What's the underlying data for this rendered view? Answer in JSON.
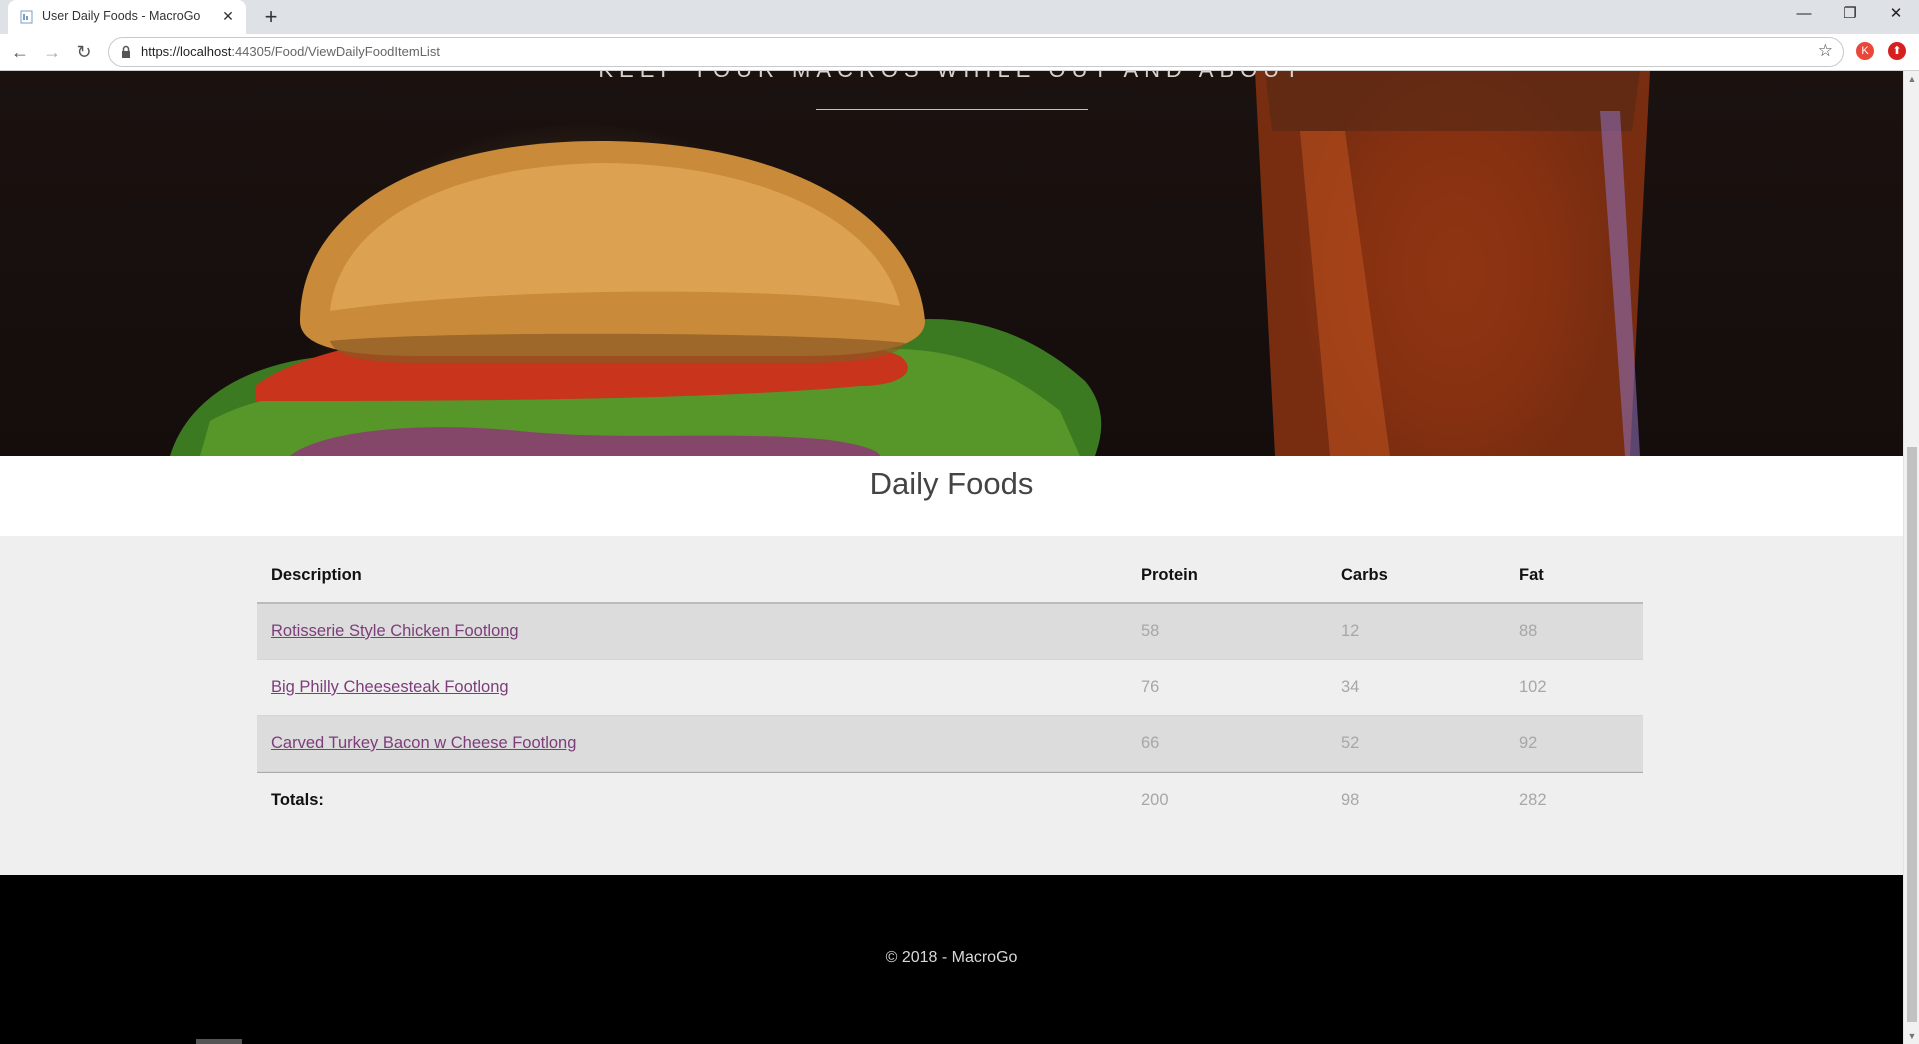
{
  "browser": {
    "tab_title": "User Daily Foods - MacroGo",
    "tab_close": "✕",
    "new_tab": "+",
    "url_host": "https://localhost",
    "url_path": ":44305/Food/ViewDailyFoodItemList",
    "profile_initial": "K",
    "window": {
      "minimize": "—",
      "restore": "❐",
      "close": "✕"
    },
    "nav": {
      "back": "←",
      "forward": "→",
      "reload": "↻",
      "bookmark": "☆"
    }
  },
  "hero": {
    "subtitle": "KEEP YOUR MACROS WHILE OUT AND ABOUT"
  },
  "page": {
    "title": "Daily Foods"
  },
  "table": {
    "headers": {
      "description": "Description",
      "protein": "Protein",
      "carbs": "Carbs",
      "fat": "Fat"
    },
    "rows": [
      {
        "description": "Rotisserie Style Chicken Footlong",
        "protein": "58",
        "carbs": "12",
        "fat": "88"
      },
      {
        "description": "Big Philly Cheesesteak Footlong",
        "protein": "76",
        "carbs": "34",
        "fat": "102"
      },
      {
        "description": "Carved Turkey Bacon w Cheese Footlong",
        "protein": "66",
        "carbs": "52",
        "fat": "92"
      }
    ],
    "totals": {
      "label": "Totals:",
      "protein": "200",
      "carbs": "98",
      "fat": "282"
    }
  },
  "footer": {
    "copyright": "© 2018 - MacroGo"
  },
  "colors": {
    "link": "#7d3d7b",
    "hero_bg": "#1b1210",
    "footer_bg": "#000000",
    "table_bg": "#efefef",
    "stripe": "#dcdcdc"
  }
}
